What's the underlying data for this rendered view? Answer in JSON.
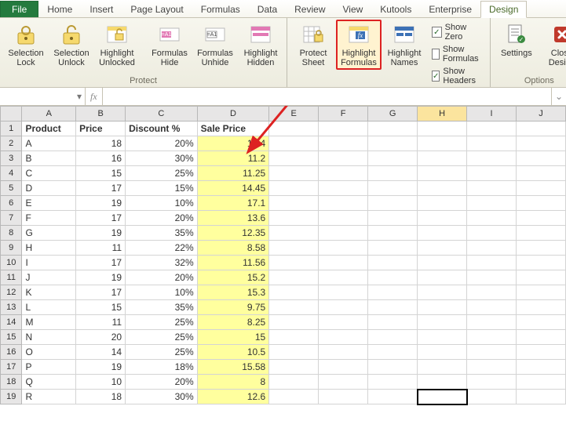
{
  "tabs": {
    "file": "File",
    "items": [
      "Home",
      "Insert",
      "Page Layout",
      "Formulas",
      "Data",
      "Review",
      "View",
      "Kutools",
      "Enterprise",
      "Design"
    ],
    "active": "Design"
  },
  "ribbon": {
    "groups": {
      "protect": {
        "label": "Protect",
        "buttons": {
          "sel_lock": "Selection\nLock",
          "sel_unlock": "Selection\nUnlock",
          "hl_unlocked": "Highlight\nUnlocked",
          "form_hide": "Formulas\nHide",
          "form_unhide": "Formulas\nUnhide",
          "hl_hidden": "Highlight\nHidden"
        }
      },
      "view": {
        "label": "View",
        "buttons": {
          "protect_sheet": "Protect\nSheet",
          "hl_formulas": "Highlight\nFormulas",
          "hl_names": "Highlight\nNames"
        },
        "checks": {
          "show_zero": {
            "label": "Show Zero",
            "checked": true
          },
          "show_formulas": {
            "label": "Show Formulas",
            "checked": false
          },
          "show_headers": {
            "label": "Show Headers",
            "checked": true
          }
        }
      },
      "options": {
        "label": "Options",
        "buttons": {
          "settings": "Settings",
          "close": "Close\nDesign"
        }
      }
    }
  },
  "fxbar": {
    "name": "",
    "fx_label": "fx",
    "formula": ""
  },
  "sheet": {
    "columns": [
      "A",
      "B",
      "C",
      "D",
      "E",
      "F",
      "G",
      "H",
      "I",
      "J"
    ],
    "selected_column": "H",
    "selected_cell": {
      "row": 19,
      "col": "H"
    },
    "headers": {
      "A": "Product",
      "B": "Price",
      "C": "Discount %",
      "D": "Sale Price"
    },
    "rows": [
      {
        "n": 2,
        "A": "A",
        "B": 18,
        "C": "20%",
        "D": 14.4
      },
      {
        "n": 3,
        "A": "B",
        "B": 16,
        "C": "30%",
        "D": 11.2
      },
      {
        "n": 4,
        "A": "C",
        "B": 15,
        "C": "25%",
        "D": 11.25
      },
      {
        "n": 5,
        "A": "D",
        "B": 17,
        "C": "15%",
        "D": 14.45
      },
      {
        "n": 6,
        "A": "E",
        "B": 19,
        "C": "10%",
        "D": 17.1
      },
      {
        "n": 7,
        "A": "F",
        "B": 17,
        "C": "20%",
        "D": 13.6
      },
      {
        "n": 8,
        "A": "G",
        "B": 19,
        "C": "35%",
        "D": 12.35
      },
      {
        "n": 9,
        "A": "H",
        "B": 11,
        "C": "22%",
        "D": 8.58
      },
      {
        "n": 10,
        "A": "I",
        "B": 17,
        "C": "32%",
        "D": 11.56
      },
      {
        "n": 11,
        "A": "J",
        "B": 19,
        "C": "20%",
        "D": 15.2
      },
      {
        "n": 12,
        "A": "K",
        "B": 17,
        "C": "10%",
        "D": 15.3
      },
      {
        "n": 13,
        "A": "L",
        "B": 15,
        "C": "35%",
        "D": 9.75
      },
      {
        "n": 14,
        "A": "M",
        "B": 11,
        "C": "25%",
        "D": 8.25
      },
      {
        "n": 15,
        "A": "N",
        "B": 20,
        "C": "25%",
        "D": 15
      },
      {
        "n": 16,
        "A": "O",
        "B": 14,
        "C": "25%",
        "D": 10.5
      },
      {
        "n": 17,
        "A": "P",
        "B": 19,
        "C": "18%",
        "D": 15.58
      },
      {
        "n": 18,
        "A": "Q",
        "B": 10,
        "C": "20%",
        "D": 8
      },
      {
        "n": 19,
        "A": "R",
        "B": 18,
        "C": "30%",
        "D": 12.6
      }
    ]
  }
}
